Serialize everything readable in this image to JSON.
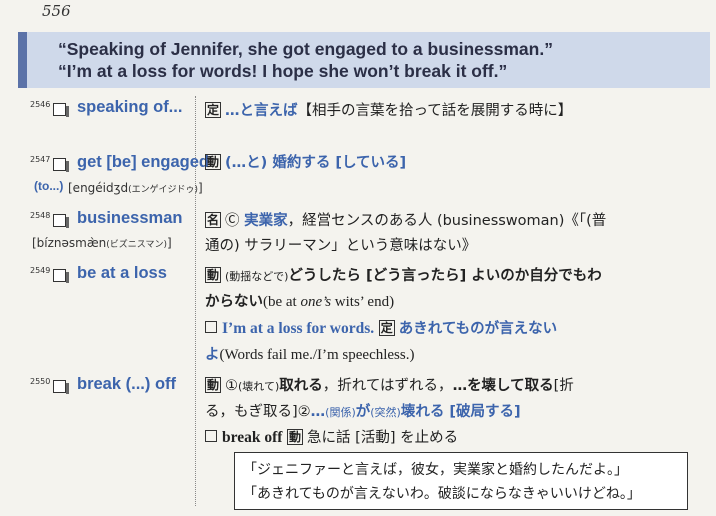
{
  "page_number": "556",
  "banner": {
    "line1": "“Speaking of Jennifer, she got engaged to a businessman.”",
    "line2": "“I’m at a loss for words! I hope she won’t break it off.”"
  },
  "entries": [
    {
      "num": "2546",
      "head": "speaking of...",
      "l1": {
        "tag": "定",
        "phrase": "…と言えば",
        "rest": "【相手の言葉を拾って話を展開する時に】"
      }
    },
    {
      "num": "2547",
      "head": "get [be] engaged",
      "head2": "(to...)",
      "pron": "[engéidʒd",
      "pron_kana": "(エンゲイジドゥ)",
      "pron_end": "]",
      "l1": {
        "tag": "動",
        "phrase": "(…と) 婚約する [している]"
      }
    },
    {
      "num": "2548",
      "head": "businessman",
      "pron": "[bíznəsmæ̀n",
      "pron_kana": "(ビズニスマン)",
      "pron_end": "]",
      "l1": {
        "tag": "名",
        "c": "Ⓒ",
        "phrase": "実業家",
        "rest": "，経営センスのある人 (businesswoman)《「(普"
      },
      "l2": "通の) サラリーマン」という意味はない》"
    },
    {
      "num": "2549",
      "head": "be at a loss",
      "l1": {
        "tag": "動",
        "small": "(動揺などで)",
        "phrase": "どうしたら [どう言ったら] よいのか自分でもわ"
      },
      "l2": {
        "a": "からない",
        "b": "(be at ",
        "c": "one’s",
        "d": " wits’ end)"
      },
      "l3": {
        "phrase_en": "I’m at a loss for words.",
        "tag": "定",
        "phrase": "あきれてものが言えない"
      },
      "l4": {
        "a": "よ",
        "b": "(Words fail me./I’m speechless.)"
      }
    },
    {
      "num": "2550",
      "head": "break (...) off",
      "l1": {
        "tag": "動",
        "a": "①",
        "b": "(壊れて)",
        "c": "取れる",
        "d": "，折れてはずれる，",
        "e": "…を壊して取る",
        "f": "[折"
      },
      "l2": {
        "a": "る，もぎ取る]",
        "b": "②",
        "c": "…",
        "d": "(関係)",
        "e": "が",
        "f": "(突然)",
        "g": "壊れる [破局する]"
      },
      "l3": {
        "phrase_en": "break off",
        "tag": "動",
        "rest": "急に話 [活動] を止める"
      }
    }
  ],
  "quote_box": {
    "line1": "「ジェニファーと言えば，彼女，実業家と婚約したんだよ。」",
    "line2": "「あきれてものが言えないわ。破談にならなきゃいいけどね。」"
  }
}
